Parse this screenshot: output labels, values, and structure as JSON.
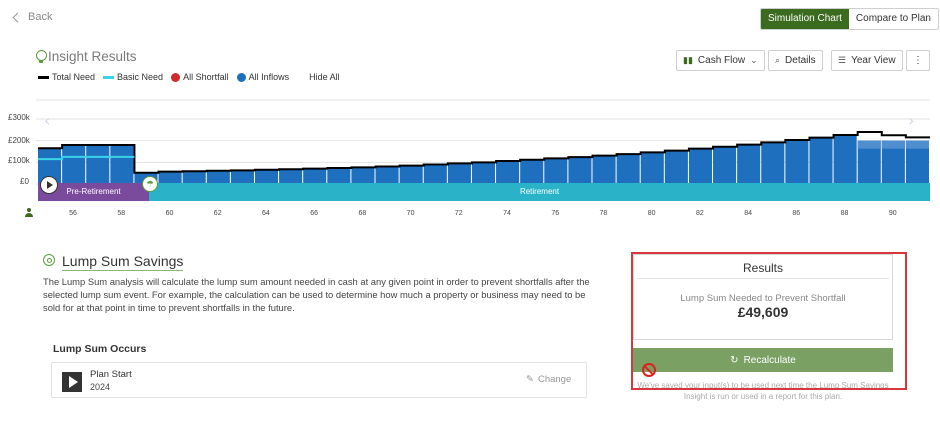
{
  "nav": {
    "back_label": "Back"
  },
  "view_toggle": {
    "simulation_label": "Simulation Chart",
    "compare_label": "Compare to Plan"
  },
  "insight": {
    "title": "Insight Results",
    "legend": [
      {
        "label": "Total Need",
        "color": "#000000",
        "kind": "line"
      },
      {
        "label": "Basic Need",
        "color": "#3ad4e8",
        "kind": "line"
      },
      {
        "label": "All Shortfall",
        "color": "#d22a2a",
        "kind": "dot"
      },
      {
        "label": "All Inflows",
        "color": "#1f6fbf",
        "kind": "dot"
      }
    ],
    "hide_all_label": "Hide All"
  },
  "toolbar": {
    "cashflow_label": "Cash Flow",
    "details_label": "Details",
    "yearview_label": "Year View",
    "more_label": "⋮"
  },
  "chart_data": {
    "type": "bar",
    "y_ticks": [
      "£300k",
      "£200k",
      "£100k",
      "£0"
    ],
    "ylim": [
      0,
      300000
    ],
    "x": [
      55,
      56,
      57,
      58,
      59,
      60,
      61,
      62,
      63,
      64,
      65,
      66,
      67,
      68,
      69,
      70,
      71,
      72,
      73,
      74,
      75,
      76,
      77,
      78,
      79,
      80,
      81,
      82,
      83,
      84,
      85,
      86,
      87,
      88,
      89,
      90,
      91
    ],
    "inflows": [
      165000,
      180000,
      180000,
      180000,
      52000,
      57000,
      59000,
      61000,
      63000,
      66000,
      68000,
      71000,
      74000,
      77000,
      81000,
      85000,
      90000,
      95000,
      100000,
      106000,
      112000,
      118000,
      124000,
      131000,
      138000,
      146000,
      154000,
      163000,
      172000,
      182000,
      192000,
      203000,
      214000,
      226000,
      200000,
      200000,
      200000
    ],
    "total_need": [
      165000,
      180000,
      180000,
      180000,
      52000,
      57000,
      59000,
      61000,
      63000,
      66000,
      68000,
      71000,
      74000,
      77000,
      81000,
      85000,
      90000,
      95000,
      100000,
      106000,
      112000,
      118000,
      124000,
      131000,
      138000,
      146000,
      154000,
      163000,
      172000,
      182000,
      192000,
      203000,
      214000,
      226000,
      240000,
      225000,
      215000
    ],
    "basic_need": [
      115000,
      125000,
      125000,
      125000
    ],
    "x_tick_labels": [
      "56",
      "58",
      "60",
      "62",
      "64",
      "66",
      "68",
      "70",
      "72",
      "74",
      "76",
      "78",
      "80",
      "82",
      "84",
      "86",
      "88",
      "90"
    ],
    "phases": {
      "pre": "Pre-Retirement",
      "post": "Retirement"
    }
  },
  "lump_sum": {
    "title": "Lump Sum Savings",
    "description": "The Lump Sum analysis will calculate the lump sum amount needed in cash at any given point in order to prevent shortfalls after the selected lump sum event. For example, the calculation can be used to determine how much a property or business may need to be sold for at that point in time to prevent shortfalls in the future.",
    "occurs_label": "Lump Sum Occurs",
    "event_name": "Plan Start",
    "event_year": "2024",
    "change_label": "Change"
  },
  "results": {
    "title": "Results",
    "subtitle": "Lump Sum Needed to Prevent Shortfall",
    "value": "£49,609",
    "recalc_label": "Recalculate",
    "note": "We've saved your input(s) to be used next time the Lump Sum Savings Insight is run or used in a report for this plan."
  }
}
